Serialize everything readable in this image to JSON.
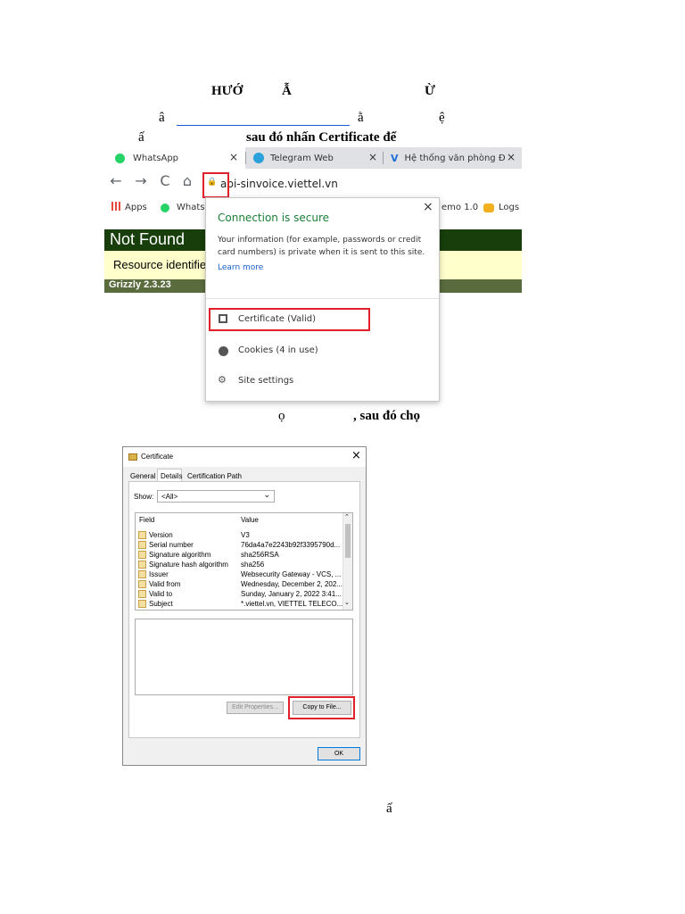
{
  "document": {
    "heading_left": "HƯỚ",
    "heading_mid": "Ẫ",
    "heading_right": "Ừ",
    "line1_char1": "â",
    "line1_char2": "ằ",
    "line1_char3": "ệ",
    "line2_char": "ấ",
    "line2_text": "sau đó nhấn Certificate để",
    "line3_char": "ọ",
    "line3_text": ", sau đó chọ",
    "footer_char": "ấ"
  },
  "browser": {
    "tabs": [
      {
        "label": "WhatsApp"
      },
      {
        "label": "Telegram Web"
      },
      {
        "label": "Hệ thống văn phòng Đ"
      }
    ],
    "tab_close": "×",
    "nav": {
      "back": "←",
      "forward": "→",
      "reload": "C",
      "home": "⌂",
      "lock": "🔒"
    },
    "url": "api-sinvoice.viettel.vn",
    "bookmarks": {
      "apps": "Apps",
      "whatsapp": "Whats",
      "demo": "emo 1.0",
      "logs": "Logs"
    },
    "page": {
      "title": "Not Found",
      "resource": "Resource identifie",
      "server": "Grizzly 2.3.23"
    }
  },
  "popup": {
    "title": "Connection is secure",
    "close": "×",
    "info": "Your information (for example, passwords or credit card numbers) is private when it is sent to this site.",
    "learn_more": "Learn more",
    "items": [
      {
        "label": "Certificate (Valid)"
      },
      {
        "label": "Cookies (4 in use)"
      },
      {
        "label": "Site settings"
      }
    ]
  },
  "dialog": {
    "title": "Certificate",
    "close": "×",
    "tabs": [
      "General",
      "Details",
      "Certification Path"
    ],
    "show_label": "Show:",
    "show_value": "<All>",
    "columns": [
      "Field",
      "Value"
    ],
    "rows": [
      {
        "field": "Version",
        "value": "V3"
      },
      {
        "field": "Serial number",
        "value": "76da4a7e2243b92f3395790d..."
      },
      {
        "field": "Signature algorithm",
        "value": "sha256RSA"
      },
      {
        "field": "Signature hash algorithm",
        "value": "sha256"
      },
      {
        "field": "Issuer",
        "value": "Websecurity Gateway - VCS, ..."
      },
      {
        "field": "Valid from",
        "value": "Wednesday, December 2, 202..."
      },
      {
        "field": "Valid to",
        "value": "Sunday, January 2, 2022 3:41..."
      },
      {
        "field": "Subject",
        "value": "*.viettel.vn, VIETTEL TELECO..."
      }
    ],
    "edit_properties": "Edit Properties...",
    "copy_to_file": "Copy to File...",
    "ok": "OK"
  },
  "colors": {
    "highlight": "#e0202a",
    "link": "#1a5fd0",
    "secure": "#1a7f37"
  }
}
